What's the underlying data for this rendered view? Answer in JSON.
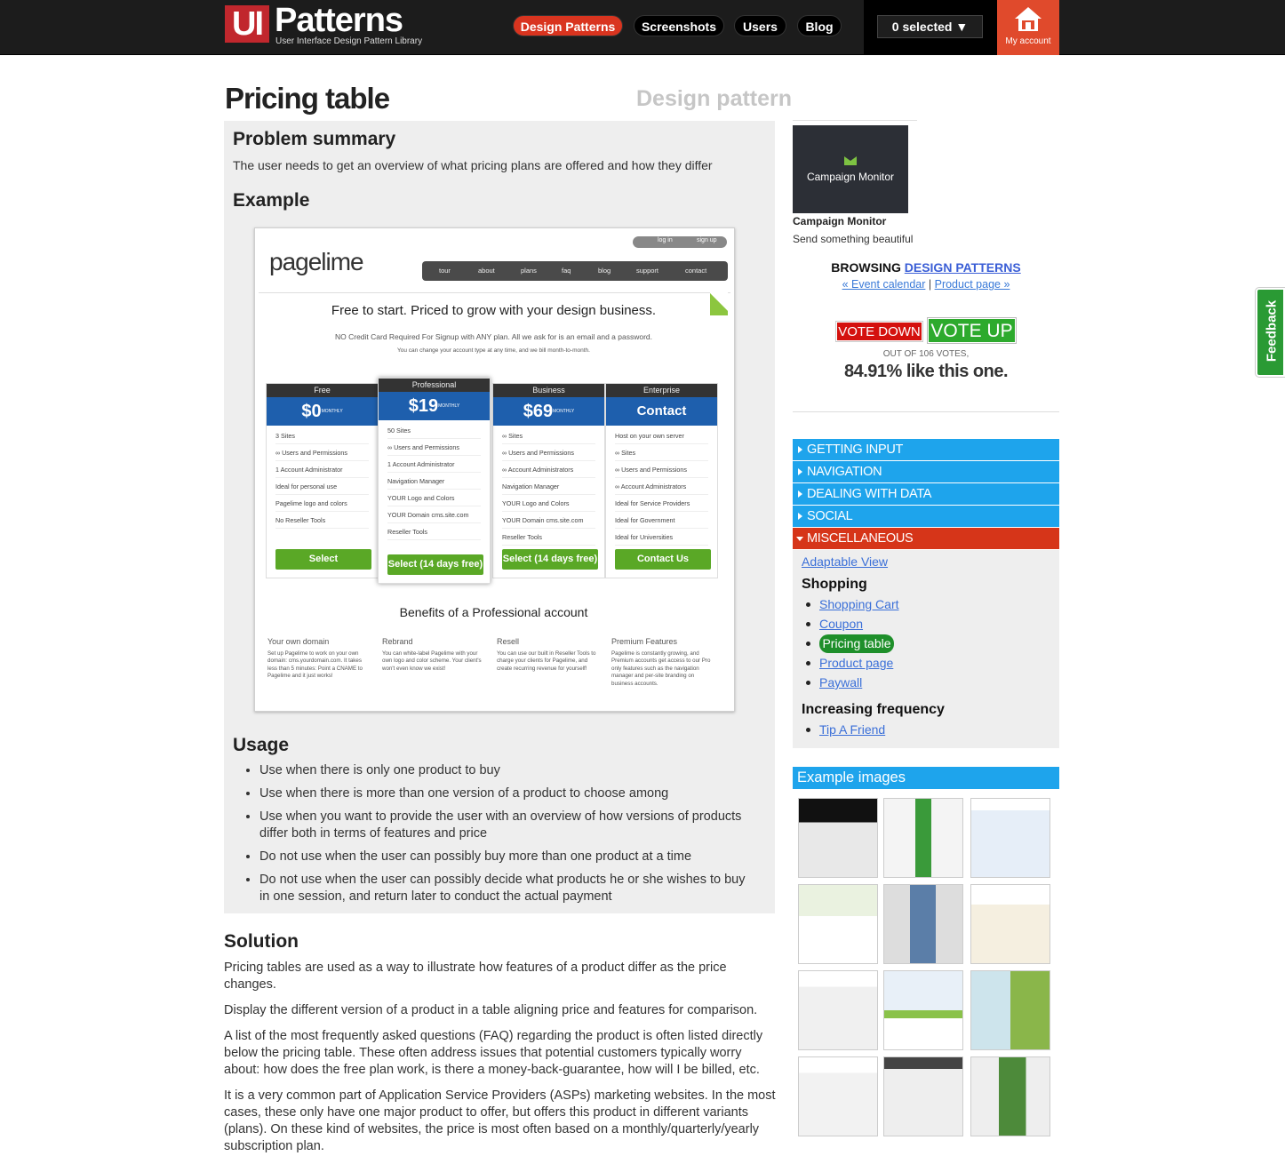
{
  "header": {
    "logo_ui": "UI",
    "logo_patterns": "Patterns",
    "logo_sub": "User Interface Design Pattern Library",
    "nav": [
      "Design Patterns",
      "Screenshots",
      "Users",
      "Blog"
    ],
    "selected": "0 selected ▼",
    "account": "My account"
  },
  "page": {
    "title": "Pricing table",
    "kind": "Design pattern",
    "problem_heading": "Problem summary",
    "problem_text": "The user needs to get an overview of what pricing plans are offered and how they differ",
    "example_heading": "Example",
    "usage_heading": "Usage",
    "usage": [
      "Use when there is only one product to buy",
      "Use when there is more than one version of a product to choose among",
      "Use when you want to provide the user with an overview of how versions of products differ both in terms of features and price",
      "Do not use when the user can possibly buy more than one product at a time",
      "Do not use when the user can possibly decide what products he or she wishes to buy in one session, and return later to conduct the actual payment"
    ],
    "solution_heading": "Solution",
    "solution": [
      "Pricing tables are used as a way to illustrate how features of a product differ as the price changes.",
      "Display the different version of a product in a table aligning price and features for comparison.",
      "A list of the most frequently asked questions (FAQ) regarding the product is often listed directly below the pricing table. These often address issues that potential customers typically worry about: how does the free plan work, is there a money-back-guarantee, how will I be billed, etc.",
      "It is a very common part of Application Service Providers (ASPs) marketing websites. In the most cases, these only have one major product to offer, but offers this product in different variants (plans). On these kind of websites, the price is most often based on a monthly/quarterly/yearly subscription plan."
    ]
  },
  "example_image": {
    "brand": "pagelime",
    "login": "log in",
    "signup": "sign up",
    "menu": [
      "tour",
      "about",
      "plans",
      "faq",
      "blog",
      "support",
      "contact"
    ],
    "headline": "Free to start. Priced to grow with your design business.",
    "note1": "NO Credit Card Required For Signup with ANY plan. All we ask for is an email and a password.",
    "note2": "You can change your account type at any time, and we bill month-to-month.",
    "plans": [
      {
        "name": "Free",
        "price": "$0",
        "period": "MONTHLY",
        "button": "Select",
        "features": [
          "3 Sites",
          "∞ Users and Permissions",
          "1 Account Administrator",
          "Ideal for personal use",
          "Pagelime logo and colors",
          "No Reseller Tools"
        ]
      },
      {
        "name": "Professional",
        "price": "$19",
        "period": "MONTHLY",
        "button": "Select (14 days free)",
        "features": [
          "50 Sites",
          "∞ Users and Permissions",
          "1 Account Administrator",
          "Navigation Manager",
          "YOUR Logo and Colors",
          "YOUR Domain cms.site.com",
          "Reseller Tools"
        ]
      },
      {
        "name": "Business",
        "price": "$69",
        "period": "MONTHLY",
        "button": "Select (14 days free)",
        "features": [
          "∞ Sites",
          "∞ Users and Permissions",
          "∞ Account Administrators",
          "Navigation Manager",
          "YOUR Logo and Colors",
          "YOUR Domain cms.site.com",
          "Reseller Tools"
        ]
      },
      {
        "name": "Enterprise",
        "price": "Contact",
        "period": "",
        "button": "Contact Us",
        "features": [
          "Host on your own server",
          "∞ Sites",
          "∞ Users and Permissions",
          "∞ Account Administrators",
          "Ideal for Service Providers",
          "Ideal for Government",
          "Ideal for Universities"
        ]
      }
    ],
    "benefits_heading": "Benefits of a Professional account",
    "benefits": [
      {
        "title": "Your own domain",
        "text": "Set up Pagelime to work on your own domain: cms.yourdomain.com. It takes less than 5 minutes: Point a CNAME to Pagelime and it just works!"
      },
      {
        "title": "Rebrand",
        "text": "You can white-label Pagelime with your own logo and color scheme. Your client's won't even know we exist!"
      },
      {
        "title": "Resell",
        "text": "You can use our built in Reseller Tools to charge your clients for Pagelime, and create recurring revenue for yourself!"
      },
      {
        "title": "Premium Features",
        "text": "Pagelime is constantly growing, and Premium accounts get access to our Pro only features such as the navigation manager and per-site branding on business accounts."
      }
    ]
  },
  "sidebar": {
    "sponsor_logo": "Campaign Monitor",
    "sponsor_name": "Campaign Monitor",
    "sponsor_tagline": "Send something beautiful",
    "browsing_prefix": "BROWSING",
    "browsing_link": "DESIGN PATTERNS",
    "prev": "« Event calendar",
    "next": "Product page »",
    "vote_down": "VOTE DOWN",
    "vote_up": "VOTE UP",
    "votes": "OUT OF 106 VOTES,",
    "percent": "84.91% like this one.",
    "categories": [
      "GETTING INPUT",
      "NAVIGATION",
      "DEALING WITH DATA",
      "SOCIAL",
      "MISCELLANEOUS"
    ],
    "misc_link": "Adaptable View",
    "shopping_heading": "Shopping",
    "shopping": [
      "Shopping Cart",
      "Coupon",
      "Pricing table",
      "Product page",
      "Paywall"
    ],
    "freq_heading": "Increasing frequency",
    "freq": [
      "Tip A Friend"
    ],
    "examples_heading": "Example images"
  },
  "feedback": "Feedback",
  "colors": {
    "accent_red": "#d9341f",
    "accent_blue": "#1ea4ec",
    "vote_green": "#2daa2d"
  }
}
